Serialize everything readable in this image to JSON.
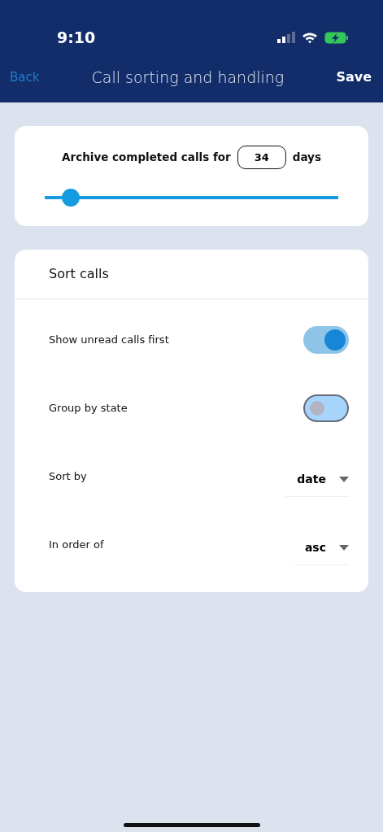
{
  "status_bar": {
    "time": "9:10"
  },
  "nav": {
    "back": "Back",
    "title": "Call sorting and handling",
    "save": "Save"
  },
  "archive": {
    "label": "Archive completed calls for",
    "value": "34",
    "unit": "days",
    "level": 0.09
  },
  "sort_section": {
    "title": "Sort calls",
    "rows": [
      {
        "kind": "toggle",
        "label": "Show unread calls first",
        "on": true
      },
      {
        "kind": "toggle",
        "label": "Group by state",
        "on": false
      },
      {
        "kind": "select",
        "label": "Sort by",
        "value": "date"
      },
      {
        "kind": "select",
        "label": "In order of",
        "value": "asc"
      }
    ]
  }
}
